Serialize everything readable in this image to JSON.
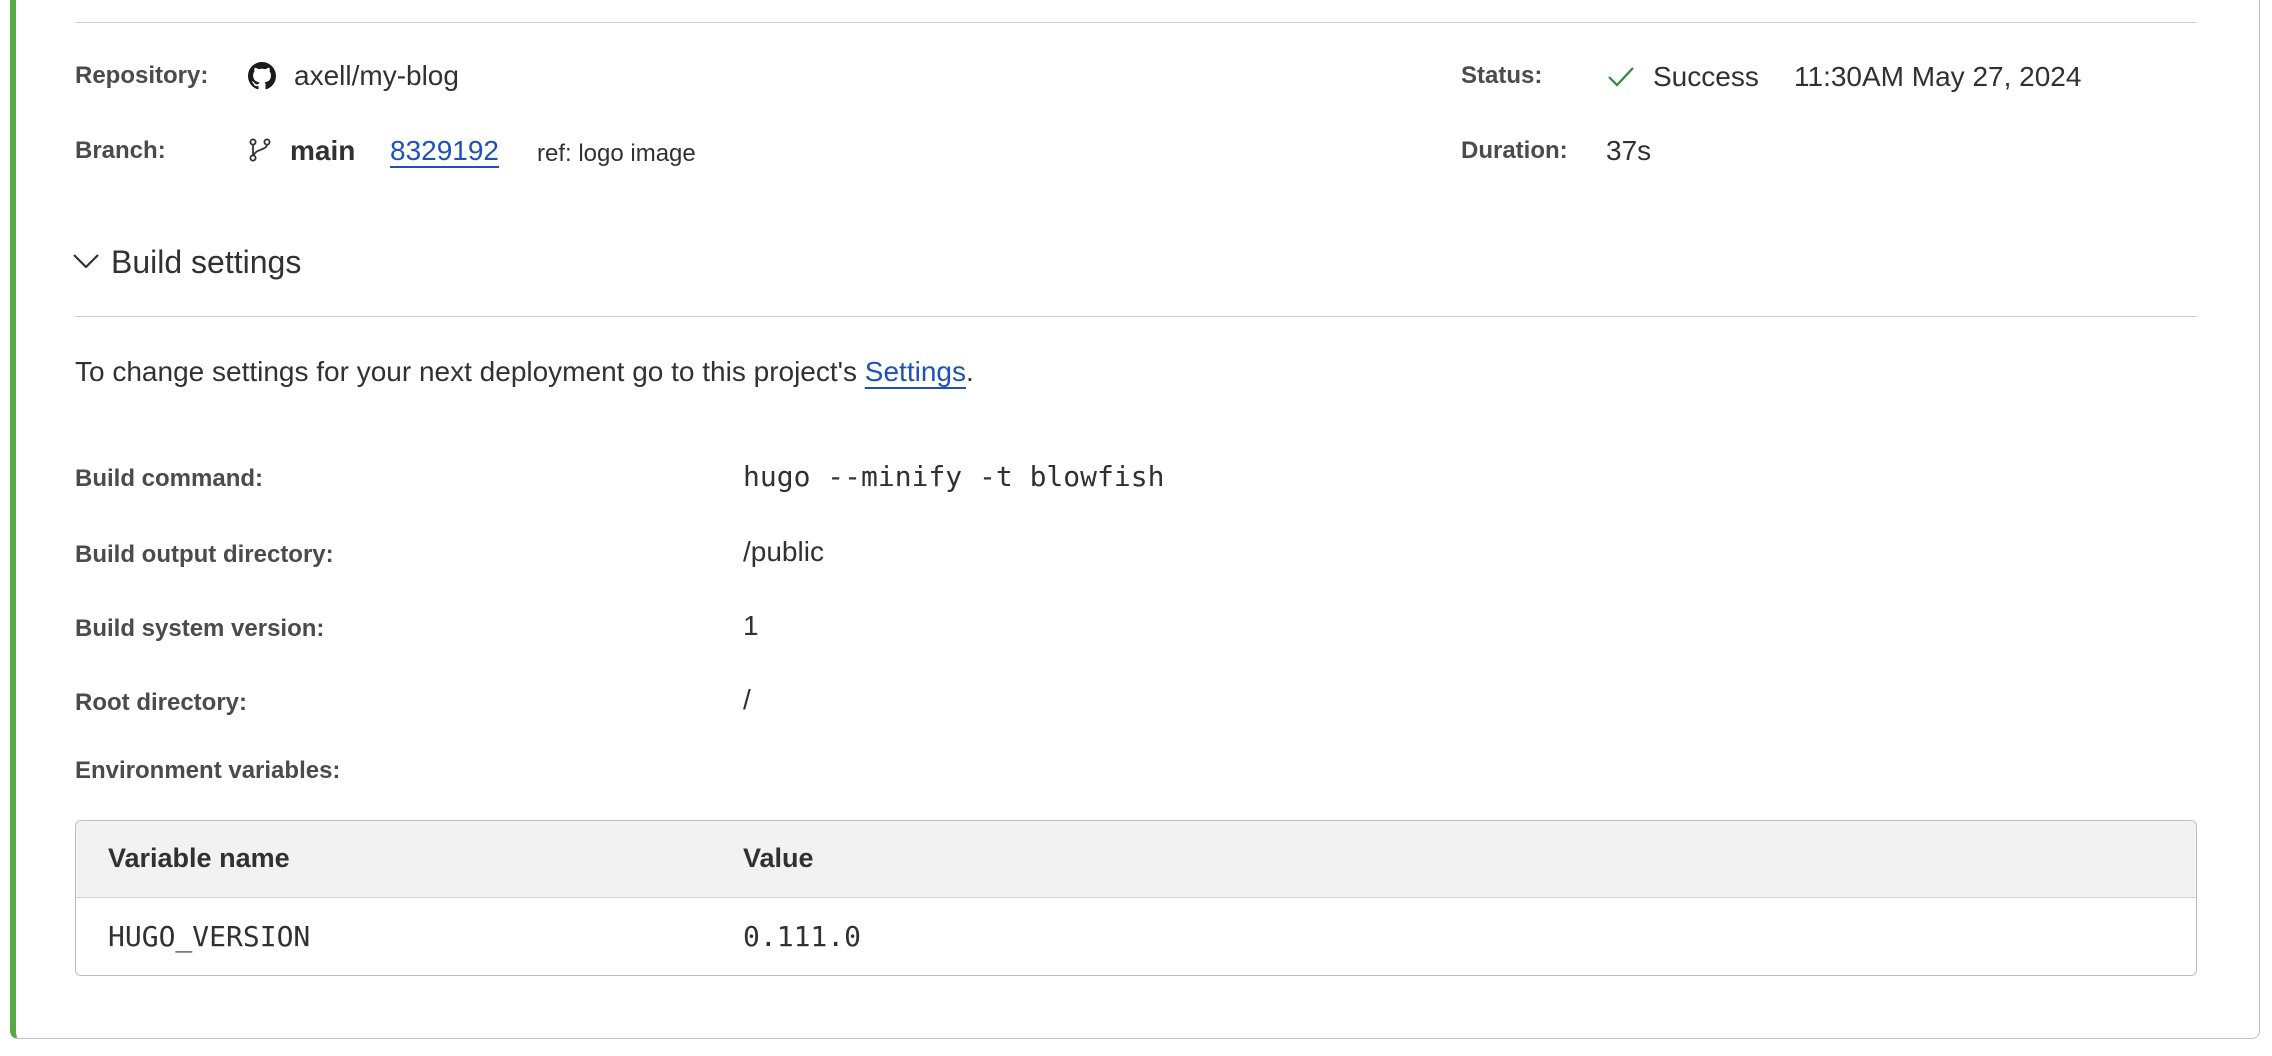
{
  "deployment": {
    "repository_label": "Repository:",
    "repository_value": "axell/my-blog",
    "branch_label": "Branch:",
    "branch_name": "main",
    "commit_hash": "8329192",
    "commit_ref": "ref: logo image",
    "status_label": "Status:",
    "status_value": "Success",
    "status_timestamp": "11:30AM May 27, 2024",
    "duration_label": "Duration:",
    "duration_value": "37s"
  },
  "build_settings": {
    "section_title": "Build settings",
    "note_prefix": "To change settings for your next deployment go to this project's ",
    "note_link": "Settings",
    "note_suffix": ".",
    "build_command_label": "Build command:",
    "build_command_value": "hugo --minify -t blowfish",
    "output_dir_label": "Build output directory:",
    "output_dir_value": "/public",
    "system_version_label": "Build system version:",
    "system_version_value": "1",
    "root_dir_label": "Root directory:",
    "root_dir_value": "/",
    "env_vars_label": "Environment variables:"
  },
  "env_table": {
    "headers": [
      "Variable name",
      "Value"
    ],
    "rows": [
      {
        "name": "HUGO_VERSION",
        "value": "0.111.0"
      }
    ]
  },
  "colors": {
    "accent_border": "#5aa843",
    "link": "#1f51b8",
    "success_check": "#2e8b3e"
  },
  "icons": {
    "repository": "github-icon",
    "branch": "git-branch-icon",
    "status": "check-icon",
    "collapse": "chevron-down-icon"
  }
}
